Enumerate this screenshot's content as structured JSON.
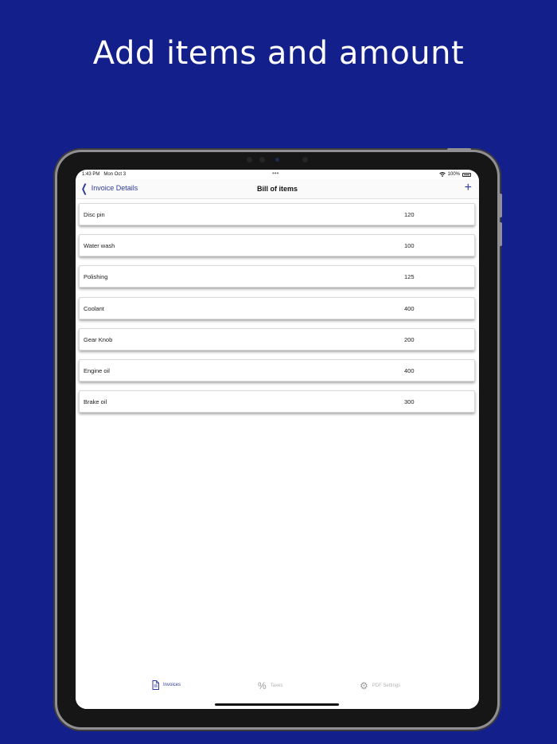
{
  "headline": "Add items and amount",
  "status_bar": {
    "time": "1:43 PM",
    "date": "Mon Oct 3",
    "battery": "100%"
  },
  "nav": {
    "back_label": "Invoice Details",
    "title": "Bill of items",
    "add_label": "+"
  },
  "items": [
    {
      "name": "Disc pin",
      "amount": "120"
    },
    {
      "name": "Water wash",
      "amount": "100"
    },
    {
      "name": "Polishing",
      "amount": "125"
    },
    {
      "name": "Coolant",
      "amount": "400"
    },
    {
      "name": "Gear Knob",
      "amount": "200"
    },
    {
      "name": "Engine oil",
      "amount": "400"
    },
    {
      "name": "Brake oil",
      "amount": "300"
    }
  ],
  "tabs": [
    {
      "label": "Invoices",
      "icon": "document-icon",
      "active": true
    },
    {
      "label": "Taxes",
      "icon": "percent-icon",
      "active": false
    },
    {
      "label": "PDF Settings",
      "icon": "gear-icon",
      "active": false
    }
  ],
  "colors": {
    "background": "#131f8a",
    "accent": "#2f3b9e"
  }
}
